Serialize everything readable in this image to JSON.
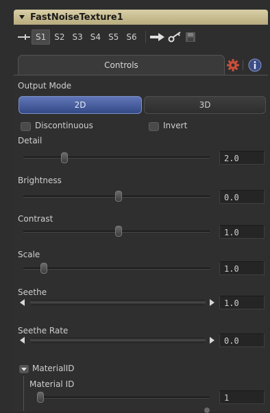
{
  "header": {
    "title": "FastNoiseTexture1"
  },
  "versions": {
    "items": [
      "S1",
      "S2",
      "S3",
      "S4",
      "S5",
      "S6"
    ],
    "active": "S1"
  },
  "tabs": {
    "controls_label": "Controls"
  },
  "output_mode": {
    "label": "Output Mode",
    "option_2d": "2D",
    "option_3d": "3D",
    "selected": "2D"
  },
  "checkboxes": {
    "discontinuous": "Discontinuous",
    "invert": "Invert"
  },
  "sliders": [
    {
      "label": "Detail",
      "value": "2.0",
      "level": 0.22
    },
    {
      "label": "Brightness",
      "value": "0.0",
      "level": 0.51
    },
    {
      "label": "Contrast",
      "value": "1.0",
      "level": 0.51
    },
    {
      "label": "Scale",
      "value": "1.0",
      "level": 0.11
    }
  ],
  "jogs": [
    {
      "label": "Seethe",
      "value": "1.0"
    },
    {
      "label": "Seethe Rate",
      "value": "0.0"
    }
  ],
  "material_group": {
    "label": "MaterialID",
    "field_label": "Material ID",
    "value": "1",
    "level": 0.02
  },
  "colors": {
    "header_bg": "#c9bd92",
    "accent_blue": "#4a5fa0",
    "panel_bg": "#2e2e2e",
    "gear_red": "#c8503a"
  }
}
